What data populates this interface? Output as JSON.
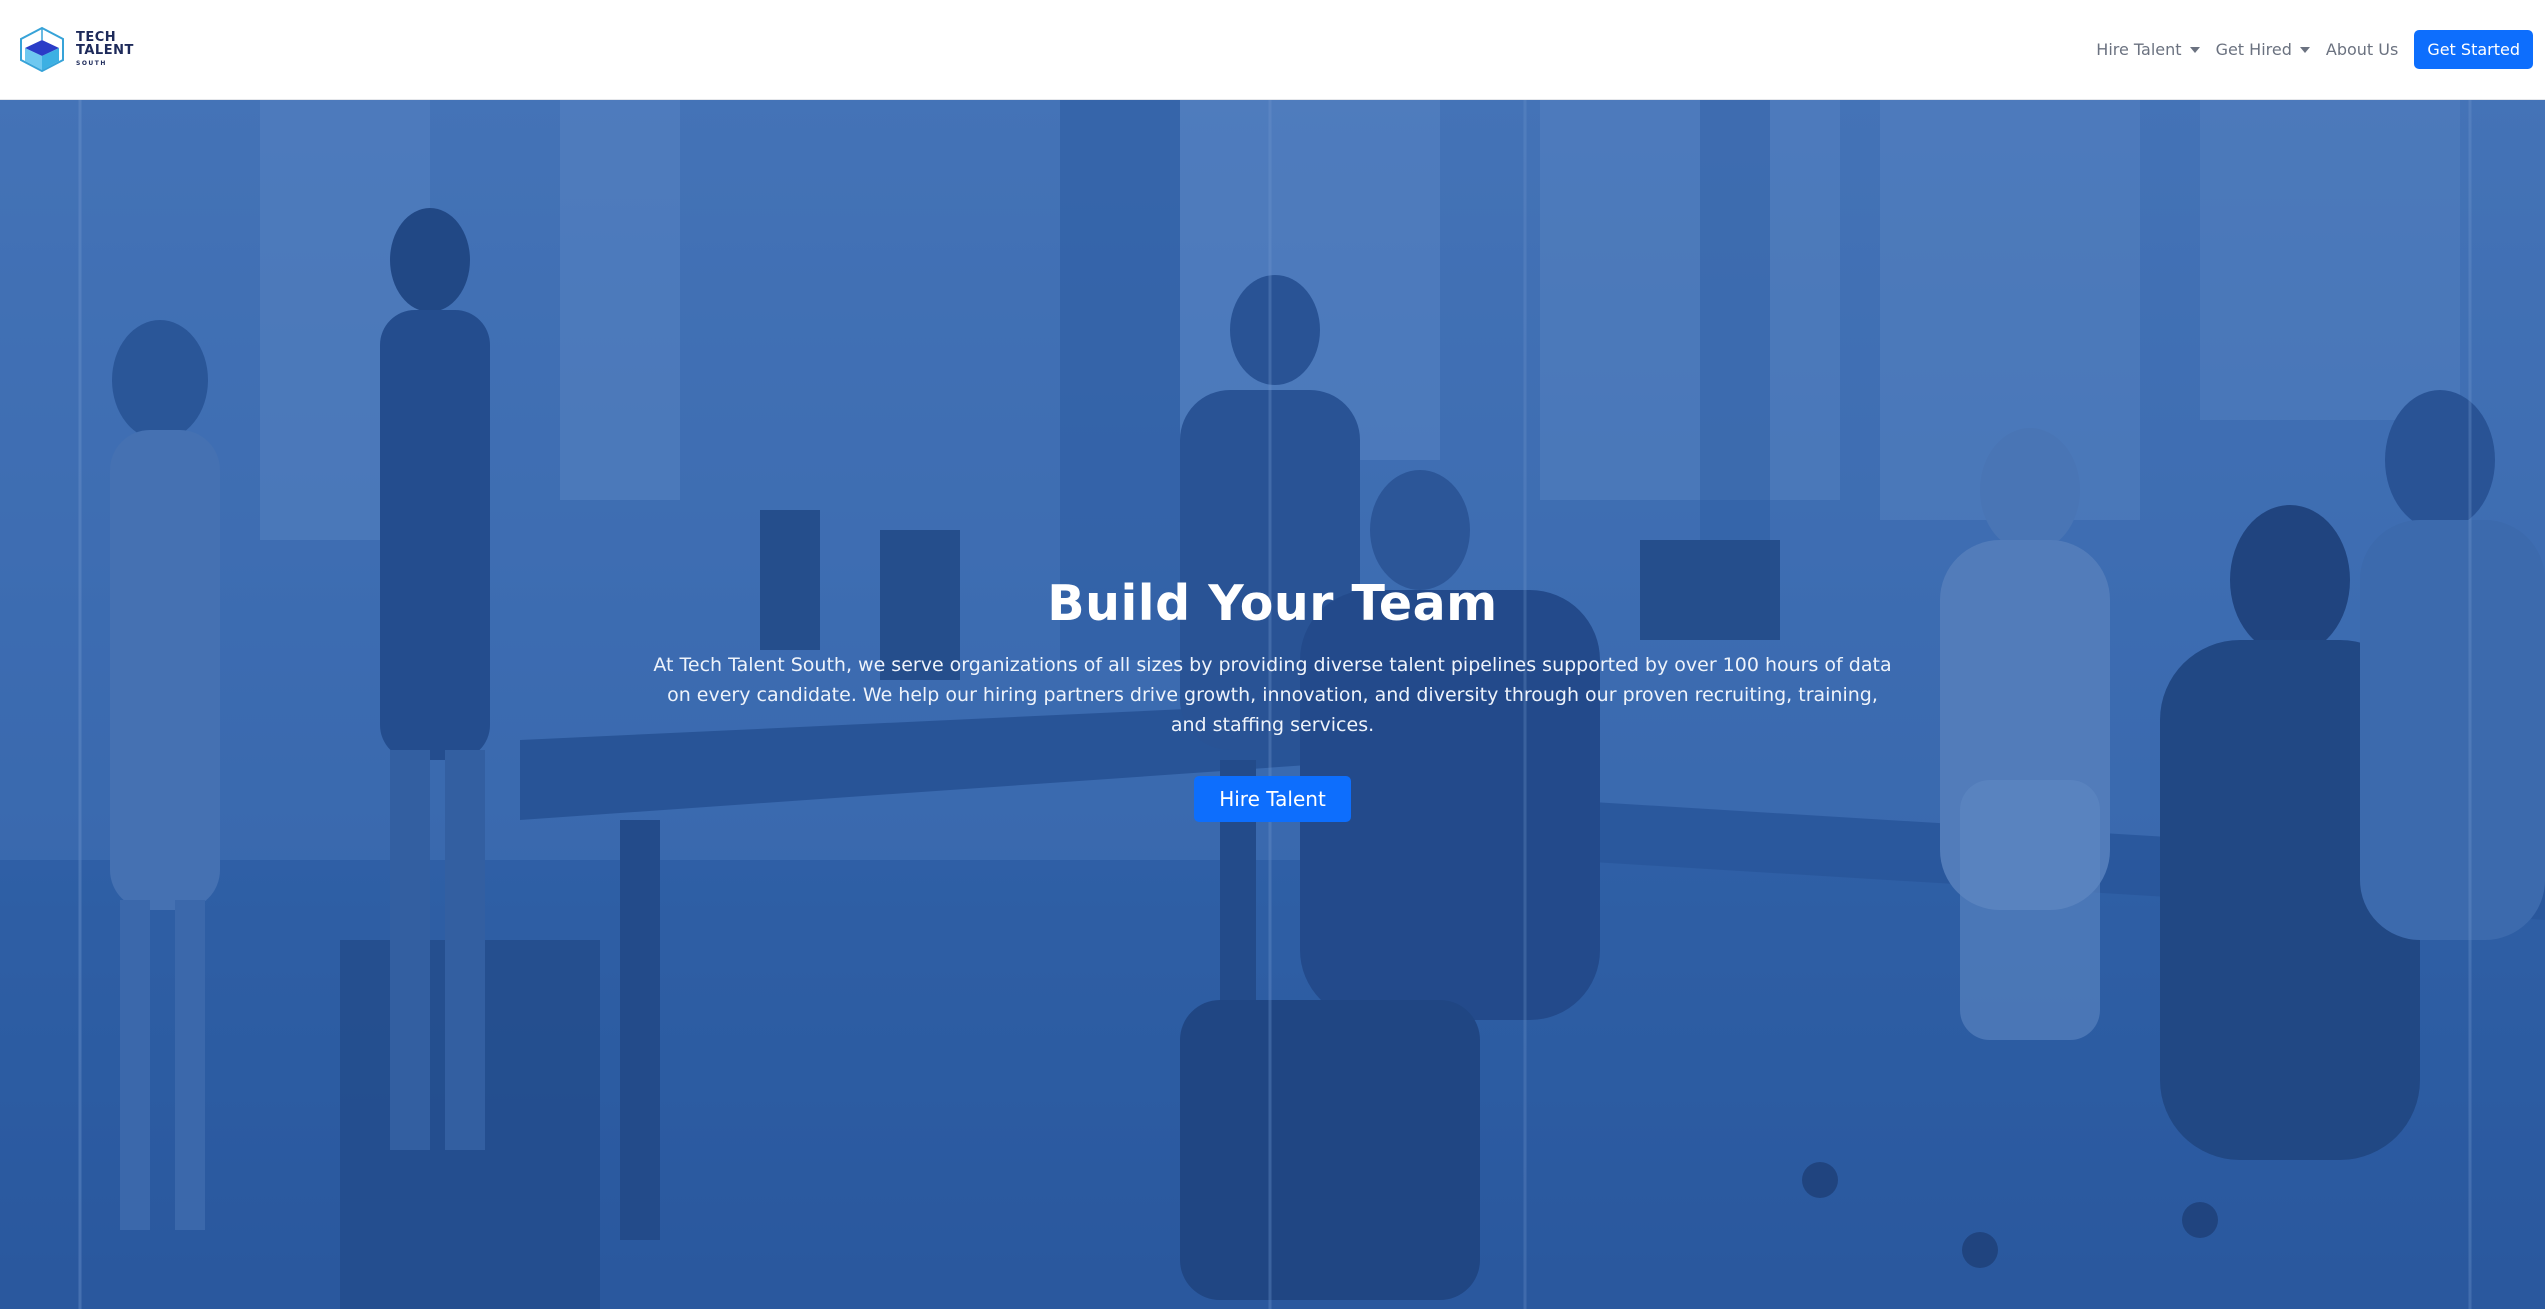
{
  "brand": {
    "line1": "TECH",
    "line2": "TALENT",
    "line3": "SOUTH"
  },
  "nav": {
    "hire_talent": "Hire Talent",
    "get_hired": "Get Hired",
    "about_us": "About Us",
    "get_started": "Get Started"
  },
  "hero": {
    "title": "Build Your Team",
    "text": "At Tech Talent South, we serve organizations of all sizes by providing diverse talent pipelines supported by over 100 hours of data on every candidate. We help our hiring partners drive growth, innovation, and diversity through our proven recruiting, training, and staffing services.",
    "cta": "Hire Talent"
  },
  "colors": {
    "primary": "#0d6efd",
    "overlay": "#2f63b0",
    "nav_text": "#6b7280",
    "brand": "#1d2a5a"
  }
}
